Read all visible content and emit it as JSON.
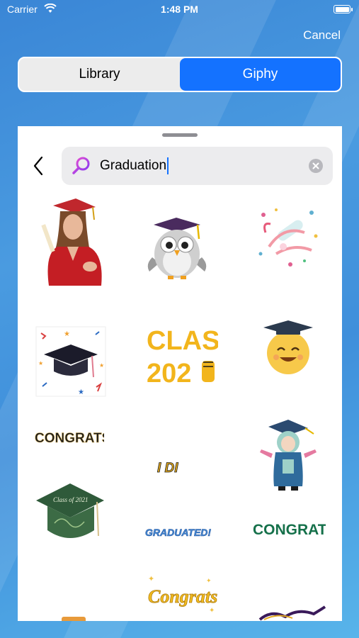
{
  "status_bar": {
    "carrier": "Carrier",
    "time": "1:48 PM"
  },
  "header": {
    "cancel_label": "Cancel"
  },
  "segmented": {
    "library_label": "Library",
    "giphy_label": "Giphy",
    "selected": "Giphy"
  },
  "search": {
    "value": "Graduation"
  },
  "colors": {
    "accent": "#1472ff",
    "background": "#3a86d6",
    "search_field": "#ececee"
  },
  "stickers": {
    "class_line1": "CLASS",
    "class_line2": "202",
    "congrats_multicolor": "CONGRATS",
    "idi": "I DI",
    "graduated": "GRADUATED!",
    "congrats_green": "CONGRATS",
    "congrats_gold": "Congrats",
    "hat_script": "Class of 2021"
  }
}
